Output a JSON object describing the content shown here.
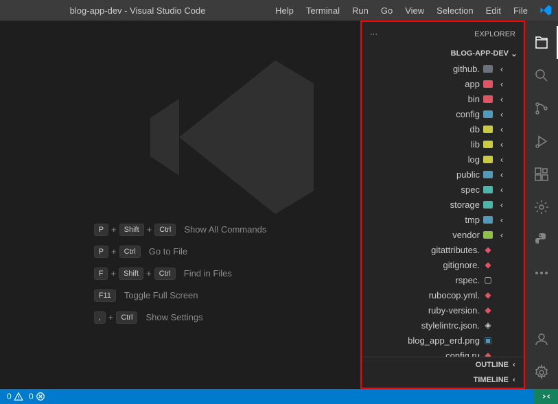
{
  "title": "blog-app-dev - Visual Studio Code",
  "menu": {
    "file": "File",
    "edit": "Edit",
    "selection": "Selection",
    "view": "View",
    "go": "Go",
    "run": "Run",
    "terminal": "Terminal",
    "help": "Help"
  },
  "explorer": {
    "title": "EXPLORER",
    "folder": "BLOG-APP-DEV",
    "items": [
      {
        "type": "folder",
        "name": ".github",
        "color": "#6a737d",
        "icon": "github"
      },
      {
        "type": "folder",
        "name": "app",
        "color": "#e05561"
      },
      {
        "type": "folder",
        "name": "bin",
        "color": "#e05561"
      },
      {
        "type": "folder",
        "name": "config",
        "color": "#519aba"
      },
      {
        "type": "folder",
        "name": "db",
        "color": "#cbcb41"
      },
      {
        "type": "folder",
        "name": "lib",
        "color": "#cbcb41"
      },
      {
        "type": "folder",
        "name": "log",
        "color": "#cbcb41"
      },
      {
        "type": "folder",
        "name": "public",
        "color": "#519aba"
      },
      {
        "type": "folder",
        "name": "spec",
        "color": "#4db6ac"
      },
      {
        "type": "folder",
        "name": "storage",
        "color": "#4db6ac"
      },
      {
        "type": "folder",
        "name": "tmp",
        "color": "#519aba"
      },
      {
        "type": "folder",
        "name": "vendor",
        "color": "#8dc149"
      },
      {
        "type": "file",
        "name": ".gitattributes",
        "color": "#e05561",
        "icon": "git"
      },
      {
        "type": "file",
        "name": ".gitignore",
        "color": "#e05561",
        "icon": "git"
      },
      {
        "type": "file",
        "name": ".rspec",
        "color": "#cccccc",
        "icon": "file"
      },
      {
        "type": "file",
        "name": ".rubocop.yml",
        "color": "#e05561",
        "icon": "ruby"
      },
      {
        "type": "file",
        "name": ".ruby-version",
        "color": "#e05561",
        "icon": "ruby"
      },
      {
        "type": "file",
        "name": ".stylelintrc.json",
        "color": "#cccccc",
        "icon": "stylelint"
      },
      {
        "type": "file",
        "name": "blog_app_erd.png",
        "color": "#519aba",
        "icon": "image"
      },
      {
        "type": "file",
        "name": "config.ru",
        "color": "#e05561",
        "icon": "ruby"
      }
    ],
    "sections": {
      "outline": "OUTLINE",
      "timeline": "TIMELINE"
    }
  },
  "shortcuts": {
    "commands": {
      "label": "Show All Commands",
      "keys": [
        "Ctrl",
        "Shift",
        "P"
      ]
    },
    "gotofile": {
      "label": "Go to File",
      "keys": [
        "Ctrl",
        "P"
      ]
    },
    "findfiles": {
      "label": "Find in Files",
      "keys": [
        "Ctrl",
        "Shift",
        "F"
      ]
    },
    "fullscreen": {
      "label": "Toggle Full Screen",
      "keys": [
        "F11"
      ]
    },
    "settings": {
      "label": "Show Settings",
      "keys": [
        "Ctrl",
        ","
      ]
    }
  },
  "status": {
    "errors": "0",
    "warnings": "0"
  }
}
